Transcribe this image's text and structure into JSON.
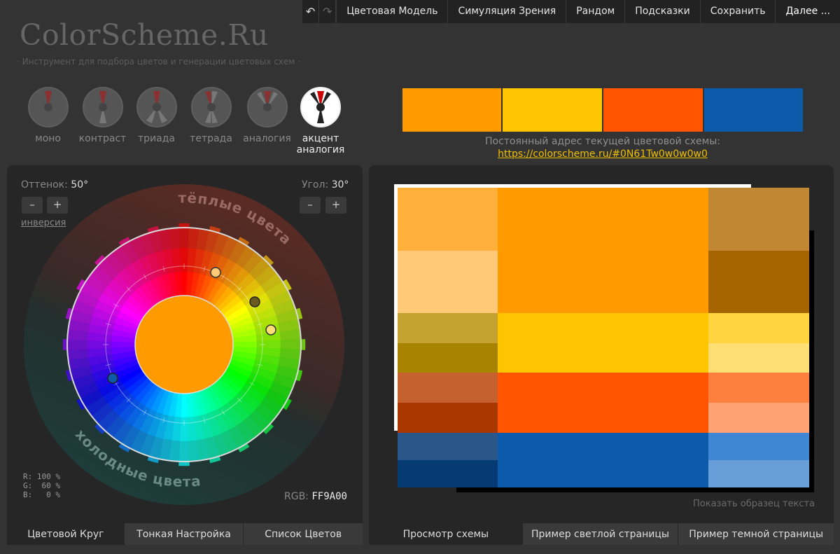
{
  "topbar": {
    "undo_icon": "undo-icon",
    "redo_icon": "redo-icon",
    "menu": [
      "Цветовая Модель",
      "Симуляция Зрения",
      "Рандом",
      "Подсказки",
      "Сохранить",
      "Далее ..."
    ]
  },
  "header": {
    "logo": "ColorScheme.Ru",
    "tagline": "· Инструмент для подбора цветов и генерации цветовых схем ·"
  },
  "schemes": [
    {
      "label": "моно",
      "active": false
    },
    {
      "label": "контраст",
      "active": false
    },
    {
      "label": "триада",
      "active": false
    },
    {
      "label": "тетрада",
      "active": false
    },
    {
      "label": "аналогия",
      "active": false
    },
    {
      "label": "акцент аналогия",
      "active": true
    }
  ],
  "swatches": [
    "#FF9A00",
    "#FFC600",
    "#FF5500",
    "#0C5AAA"
  ],
  "address": {
    "label": "Постоянный адрес текущей цветовой схемы:",
    "url": "https://colorscheme.ru/#0N61Tw0w0w0w0"
  },
  "wheel": {
    "hue_label": "Оттенок:",
    "hue_value": "50°",
    "angle_label": "Угол:",
    "angle_value": "30°",
    "minus": "–",
    "plus": "+",
    "inversion": "инверсия",
    "warm_label": "тёплые цвета",
    "cold_label": "холодные цвета",
    "center_color": "#FF9A00",
    "rgb_percent": "R: 100 %\nG:  60 %\nB:   0 %",
    "rgb_label": "RGB:",
    "rgb_hex": "FF9A00"
  },
  "tabs_left": [
    {
      "label": "Цветовой Круг",
      "active": true
    },
    {
      "label": "Тонкая Настройка",
      "active": false
    },
    {
      "label": "Список Цветов",
      "active": false
    }
  ],
  "preview": {
    "rows": [
      {
        "left": [
          "#FFB03B",
          "#FFC977"
        ],
        "main": "#FF9A00",
        "right": [
          "#C28733",
          "#A66400"
        ]
      },
      {
        "left": [
          "#C4A230",
          "#A88300"
        ],
        "main": "#FFC600",
        "right": [
          "#FFD43F",
          "#FFDE73"
        ]
      },
      {
        "left": [
          "#C4612F",
          "#A83700"
        ],
        "main": "#FF5500",
        "right": [
          "#FF7F3F",
          "#FFA273"
        ]
      },
      {
        "left": [
          "#2A5588",
          "#053A73"
        ],
        "main": "#0C5AAA",
        "right": [
          "#3F86D4",
          "#689FD8"
        ]
      }
    ],
    "show_text_sample": "Показать образец текста"
  },
  "tabs_right": [
    {
      "label": "Просмотр схемы",
      "active": true
    },
    {
      "label": "Пример светлой страницы",
      "active": false
    },
    {
      "label": "Пример темной страницы",
      "active": false
    }
  ]
}
